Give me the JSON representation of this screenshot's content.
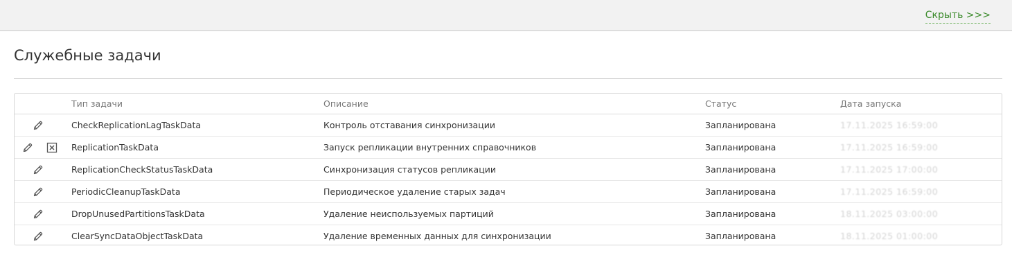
{
  "topbar": {
    "hide_label": "Скрыть >>>"
  },
  "page": {
    "title": "Служебные задачи"
  },
  "table": {
    "columns": {
      "type": "Тип задачи",
      "description": "Описание",
      "status": "Статус",
      "start_date": "Дата запуска"
    },
    "rows": [
      {
        "type": "CheckReplicationLagTaskData",
        "description": "Контроль отставания синхронизации",
        "status": "Запланирована",
        "start_date": "17.11.2025 16:59:00",
        "has_delete": false
      },
      {
        "type": "ReplicationTaskData",
        "description": "Запуск репликации внутренних справочников",
        "status": "Запланирована",
        "start_date": "17.11.2025 16:59:00",
        "has_delete": true
      },
      {
        "type": "ReplicationCheckStatusTaskData",
        "description": "Синхронизация статусов репликации",
        "status": "Запланирована",
        "start_date": "17.11.2025 17:00:00",
        "has_delete": false
      },
      {
        "type": "PeriodicCleanupTaskData",
        "description": "Периодическое удаление старых задач",
        "status": "Запланирована",
        "start_date": "17.11.2025 16:59:00",
        "has_delete": false
      },
      {
        "type": "DropUnusedPartitionsTaskData",
        "description": "Удаление неиспользуемых партиций",
        "status": "Запланирована",
        "start_date": "18.11.2025 03:00:00",
        "has_delete": false
      },
      {
        "type": "ClearSyncDataObjectTaskData",
        "description": "Удаление временных данных для синхронизации",
        "status": "Запланирована",
        "start_date": "18.11.2025 01:00:00",
        "has_delete": false
      }
    ]
  },
  "icons": {
    "edit": "pencil-icon",
    "delete": "close-box-icon"
  },
  "colors": {
    "link": "#3a8a2a",
    "header_text": "#777777",
    "topbar_bg": "#f2f2f2"
  }
}
